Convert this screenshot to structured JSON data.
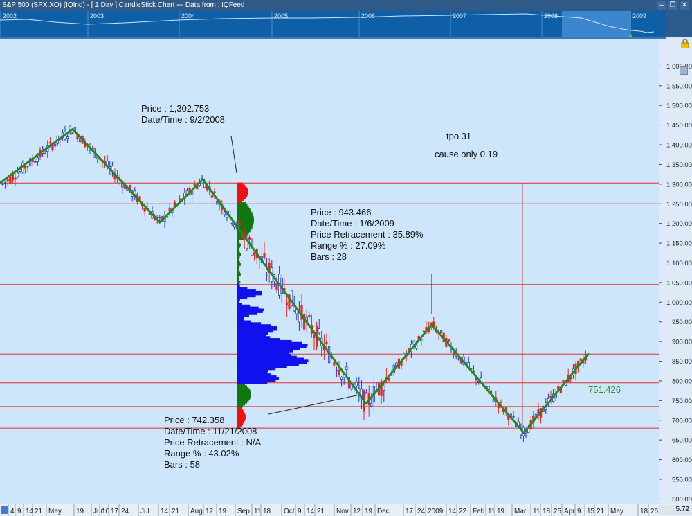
{
  "window": {
    "title": "S&P 500 (SPX.XO) (IQInd) -  [ 1 Day ] CandleStick Chart --- Data from : IQFeed"
  },
  "overview": {
    "years": [
      "2002",
      "2003",
      "2004",
      "2005",
      "2006",
      "2007",
      "2008",
      "2009"
    ]
  },
  "annotations": [
    {
      "line0": "Price : 1,302.753",
      "line1": "Date/Time : 9/2/2008"
    },
    {
      "line0": "Price : 943.466",
      "line1": "Date/Time : 1/6/2009",
      "line2": "Price Retracement : 35.89%",
      "line3": "Range % : 27.09%",
      "line4": "Bars : 28"
    },
    {
      "line0": "Price : 742.358",
      "line1": "Date/Time : 11/21/2008",
      "line2": "Price Retracement : N/A",
      "line3": "Range % : 43.02%",
      "line4": "Bars : 58"
    }
  ],
  "notes": {
    "tpo": "tpo 31",
    "cause": "cause only 0.19"
  },
  "level_label": "751.426",
  "corner_value": "5.72",
  "chart_data": {
    "type": "candlestick",
    "title": "S&P 500 (SPX.XO)",
    "interval": "1 Day",
    "ylim": [
      470,
      1650
    ],
    "price_ticks": [
      "1,600.00",
      "1,550.00",
      "1,500.00",
      "1,450.00",
      "1,400.00",
      "1,350.00",
      "1,300.00",
      "1,250.00",
      "1,200.00",
      "1,150.00",
      "1,100.00",
      "1,050.00",
      "1,000.00",
      "950.00",
      "900.00",
      "850.00",
      "800.00",
      "750.00",
      "700.00",
      "650.00",
      "600.00",
      "550.00",
      "500.00"
    ],
    "time_ticks": [
      "4",
      "9",
      "14",
      "21",
      "May",
      "19",
      "Jun",
      "10",
      "17",
      "24",
      "Jul",
      "14",
      "21",
      "Aug",
      "12",
      "19",
      "Sep",
      "11",
      "18",
      "Oct",
      "9",
      "14",
      "21",
      "Nov",
      "12",
      "19",
      "Dec",
      "17",
      "24",
      "2009",
      "14",
      "22",
      "Feb",
      "11",
      "19",
      "Mar",
      "11",
      "18",
      "25",
      "Apr",
      "9",
      "15",
      "21",
      "May",
      "18",
      "26"
    ],
    "horizontal_levels": [
      1302.75,
      1250,
      1045,
      868,
      795,
      735,
      680
    ],
    "swings": [
      {
        "date": "4/1/2008",
        "price": 1305
      },
      {
        "date": "5/19/2008",
        "price": 1440
      },
      {
        "date": "7/15/2008",
        "price": 1203
      },
      {
        "date": "8/11/2008",
        "price": 1312
      },
      {
        "date": "11/21/2008",
        "price": 742.358
      },
      {
        "date": "1/6/2009",
        "price": 943.466
      },
      {
        "date": "3/6/2009",
        "price": 668
      },
      {
        "date": "4/17/2009",
        "price": 870
      }
    ],
    "annotated_points": [
      {
        "label": "9/2/2008",
        "price": 1302.753
      },
      {
        "label": "11/21/2008",
        "price": 742.358
      },
      {
        "label": "1/6/2009",
        "price": 943.466
      }
    ]
  }
}
